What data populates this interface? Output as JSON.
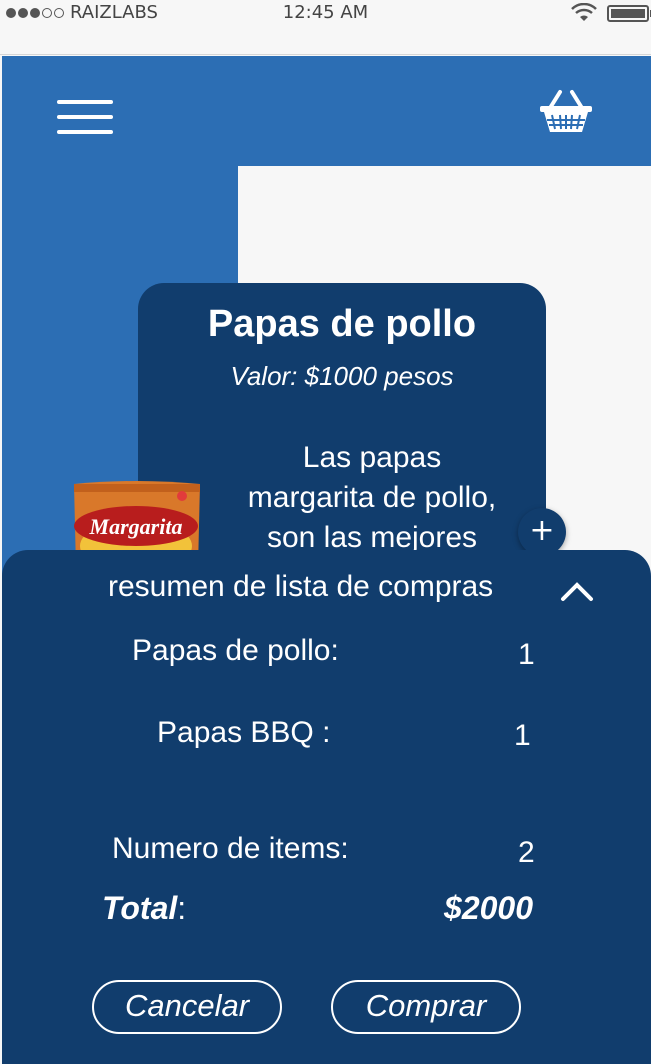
{
  "status_bar": {
    "carrier": "RAIZLABS",
    "time": "12:45 AM",
    "signal_bars": 5,
    "signal_filled": 3,
    "battery_level": 1.0
  },
  "header": {
    "menu_icon": "hamburger-menu-icon",
    "cart_icon": "shopping-basket-icon"
  },
  "product": {
    "title": "Papas de pollo",
    "price": "Valor: $1000  pesos",
    "description_lines": [
      "Las papas",
      "margarita de pollo,",
      "son las mejores"
    ],
    "image_brand": "Margarita",
    "add_label": "+"
  },
  "summary": {
    "title": "resumen de lista de compras",
    "items": [
      {
        "name": "Papas de pollo:",
        "qty": "1"
      },
      {
        "name": "Papas BBQ :",
        "qty": "1"
      }
    ],
    "count_label": "Numero de items:",
    "count_value": "2",
    "total_label": "Total",
    "total_sep": ":",
    "total_value": "$2000",
    "cancel_label": "Cancelar",
    "buy_label": "Comprar"
  },
  "colors": {
    "blue": "#2c6eb4",
    "navy": "#113d6d",
    "panel": "#f7f7f7"
  }
}
